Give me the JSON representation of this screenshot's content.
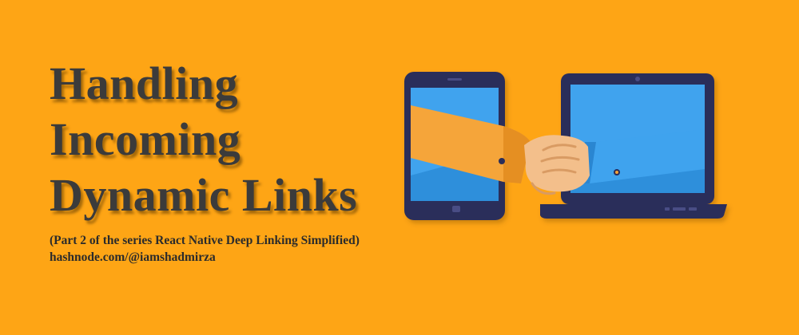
{
  "banner": {
    "background_color": "#fea515",
    "title_lines": [
      "Handling",
      "Incoming",
      "Dynamic Links"
    ],
    "subtitle": "(Part 2 of the series React Native Deep Linking Simplified)",
    "url": "hashnode.com/@iamshadmirza"
  },
  "illustration": {
    "devices": [
      "tablet-icon",
      "laptop-icon"
    ],
    "center_motif": "handshake-icon",
    "colors": {
      "device_frame": "#2a2d5a",
      "screen": "#3fa3ee",
      "sleeve": "#f5a53a",
      "skin": "#f3bf8b"
    }
  }
}
